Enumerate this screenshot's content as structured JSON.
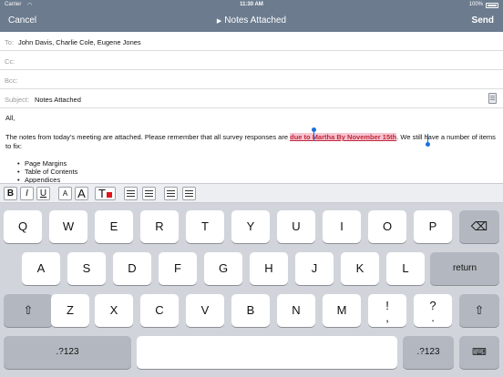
{
  "status_bar": {
    "carrier": "Carrier",
    "wifi_icon": "wifi-icon",
    "time": "11:30 AM",
    "battery": "100%"
  },
  "nav": {
    "cancel": "Cancel",
    "title": "Notes Attached",
    "title_icon": "disclosure-triangle-icon",
    "send": "Send"
  },
  "fields": {
    "to_label": "To:",
    "to_value": "John Davis, Charlie Cole, Eugene Jones",
    "cc_label": "Cc:",
    "bcc_label": "Bcc:",
    "subject_label": "Subject:",
    "subject_value": "Notes Attached",
    "attachment_icon": "clipboard-icon"
  },
  "body": {
    "greeting": "All,",
    "para_before": "The notes from today’s meeting are attached.  Please remember that all survey responses are ",
    "para_selected": "due to Martha By November 15th",
    "para_after": ". We still have a number of items to fix:",
    "bullets": [
      "Page Margins",
      "Table of Contents",
      "Appendices"
    ]
  },
  "toolbar": {
    "bold": "B",
    "italic": "I",
    "underline": "U",
    "font_small": "A",
    "font_large": "A",
    "text_color": "T",
    "text_color_value": "#e0161c",
    "bullet_list_icon": "bullet-list-icon",
    "numbered_list_icon": "numbered-list-icon",
    "outdent_icon": "outdent-icon",
    "indent_icon": "indent-icon"
  },
  "keyboard": {
    "row1": [
      "Q",
      "W",
      "E",
      "R",
      "T",
      "Y",
      "U",
      "I",
      "O",
      "P"
    ],
    "backspace_icon": "backspace-icon",
    "row2": [
      "A",
      "S",
      "D",
      "F",
      "G",
      "H",
      "J",
      "K",
      "L"
    ],
    "return": "return",
    "shift_icon": "shift-icon",
    "row3": [
      "Z",
      "X",
      "C",
      "V",
      "B",
      "N",
      "M"
    ],
    "punct1_top": "!",
    "punct1_bottom": ",",
    "punct2_top": "?",
    "punct2_bottom": ".",
    "numbers": ".?123",
    "hide_keyboard_icon": "hide-keyboard-icon"
  }
}
